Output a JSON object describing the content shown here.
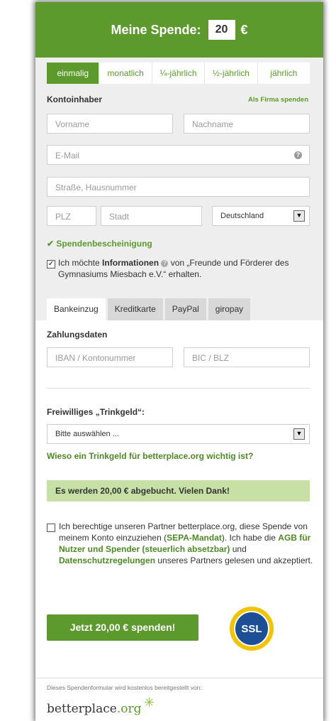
{
  "header": {
    "title": "Meine Spende:",
    "amount": "20",
    "currency": "€"
  },
  "frequency": [
    "einmalig",
    "monatlich",
    "¼-jährlich",
    "½-jährlich",
    "jährlich"
  ],
  "account": {
    "label": "Kontoinhaber",
    "company_link": "Als Firma spenden",
    "first_name_placeholder": "Vorname",
    "last_name_placeholder": "Nachname",
    "email_placeholder": "E-Mail",
    "street_placeholder": "Straße, Hausnummer",
    "zip_placeholder": "PLZ",
    "city_placeholder": "Stadt",
    "country": "Deutschland"
  },
  "receipt_label": "Spendenbescheinigung",
  "info_opt_in": {
    "prefix": "Ich möchte ",
    "bold": "Informationen",
    "suffix": " von „Freunde und Förderer des Gymnasiums Miesbach e.V.“ erhalten."
  },
  "payment_tabs": [
    "Bankeinzug",
    "Kreditkarte",
    "PayPal",
    "giropay"
  ],
  "payment": {
    "label": "Zahlungsdaten",
    "iban_placeholder": "IBAN / Kontonummer",
    "bic_placeholder": "BIC / BLZ"
  },
  "tip": {
    "label": "Freiwilliges „Trinkgeld“:",
    "select_value": "Bitte auswählen ...",
    "link": "Wieso ein Trinkgeld für betterplace.org wichtig ist?"
  },
  "notice": "Es werden 20,00 € abgebucht. Vielen Dank!",
  "consent": {
    "p1": "Ich berechtige unseren Partner betterplace.org, diese Spende von meinem Konto einzuziehen (",
    "sepa": "SEPA-Mandat",
    "p2": "). Ich habe die ",
    "agb": "AGB für Nutzer und Spender (steuerlich absetzbar)",
    "p3": " und ",
    "privacy": "Datenschutzregelungen",
    "p4": " unseres Partners gelesen und akzeptiert."
  },
  "submit_button": "Jetzt 20,00 € spenden!",
  "ssl_badge": "SSL",
  "footer": {
    "note": "Dieses Spendenformular wird kostenlos bereitgestellt von:",
    "brand_main": "betterplace",
    "brand_tld": ".org"
  },
  "colors": {
    "primary": "#5c9a2d",
    "notice_bg": "#c6e0a6",
    "panel_bg": "#eeeeee"
  }
}
